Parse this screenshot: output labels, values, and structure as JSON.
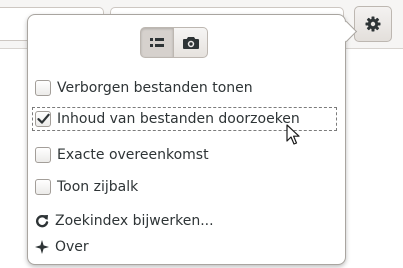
{
  "icons": {
    "gear": "gear-icon",
    "list_view": "list-view-icon",
    "camera": "camera-icon",
    "check": "checkmark-icon",
    "refresh": "refresh-icon",
    "about": "star-icon",
    "cursor": "mouse-pointer-icon"
  },
  "popover": {
    "view_toggle": {
      "options": [
        "list",
        "camera"
      ],
      "active": "list"
    },
    "options": [
      {
        "label": "Verborgen bestanden tonen",
        "checked": false
      },
      {
        "label": "Inhoud van bestanden doorzoeken",
        "checked": true
      },
      {
        "label": "Exacte overeenkomst",
        "checked": false
      },
      {
        "label": "Toon zijbalk",
        "checked": false
      }
    ],
    "actions": [
      {
        "label": "Zoekindex bijwerken..."
      },
      {
        "label": "Over"
      }
    ]
  },
  "colors": {
    "text": "#2e3436",
    "popover_border": "#a9a5a0",
    "header_bg": "#f6f5f4",
    "toggle_active_bg": "#d6d1cd"
  }
}
